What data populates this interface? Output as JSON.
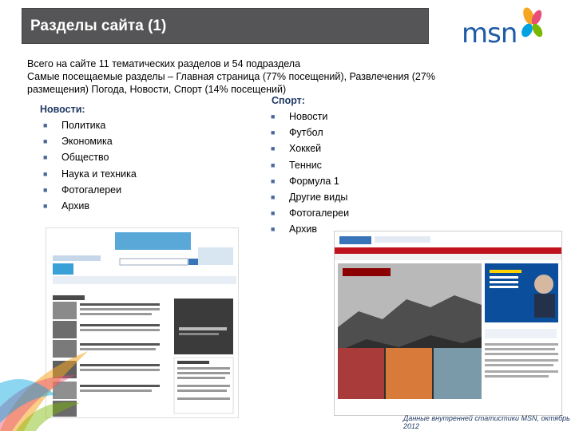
{
  "header": {
    "title": "Разделы сайта (1)"
  },
  "logo": {
    "text": "msn"
  },
  "summary": {
    "line1": "Всего на сайте 11 тематических разделов и 54 подраздела",
    "line2": "Самые посещаемые разделы – Главная страница (77% посещений), Развлечения (27%",
    "line3": "размещения) Погода, Новости, Спорт (14% посещений)"
  },
  "news": {
    "heading": "Новости:",
    "items": [
      "Политика",
      "Экономика",
      "Общество",
      "Наука и техника",
      "Фотогалереи",
      "Архив"
    ]
  },
  "sport": {
    "heading": "Спорт:",
    "items": [
      "Новости",
      "Футбол",
      "Хоккей",
      "Теннис",
      "Формула 1",
      "Другие виды",
      "Фотогалереи",
      "Архив"
    ]
  },
  "footer": {
    "source": "Данные внутренней статистики MSN, октябрь 2012"
  },
  "colors": {
    "header_bg": "#555557",
    "accent_blue": "#1f5aa6",
    "heading_blue": "#1f3864"
  }
}
